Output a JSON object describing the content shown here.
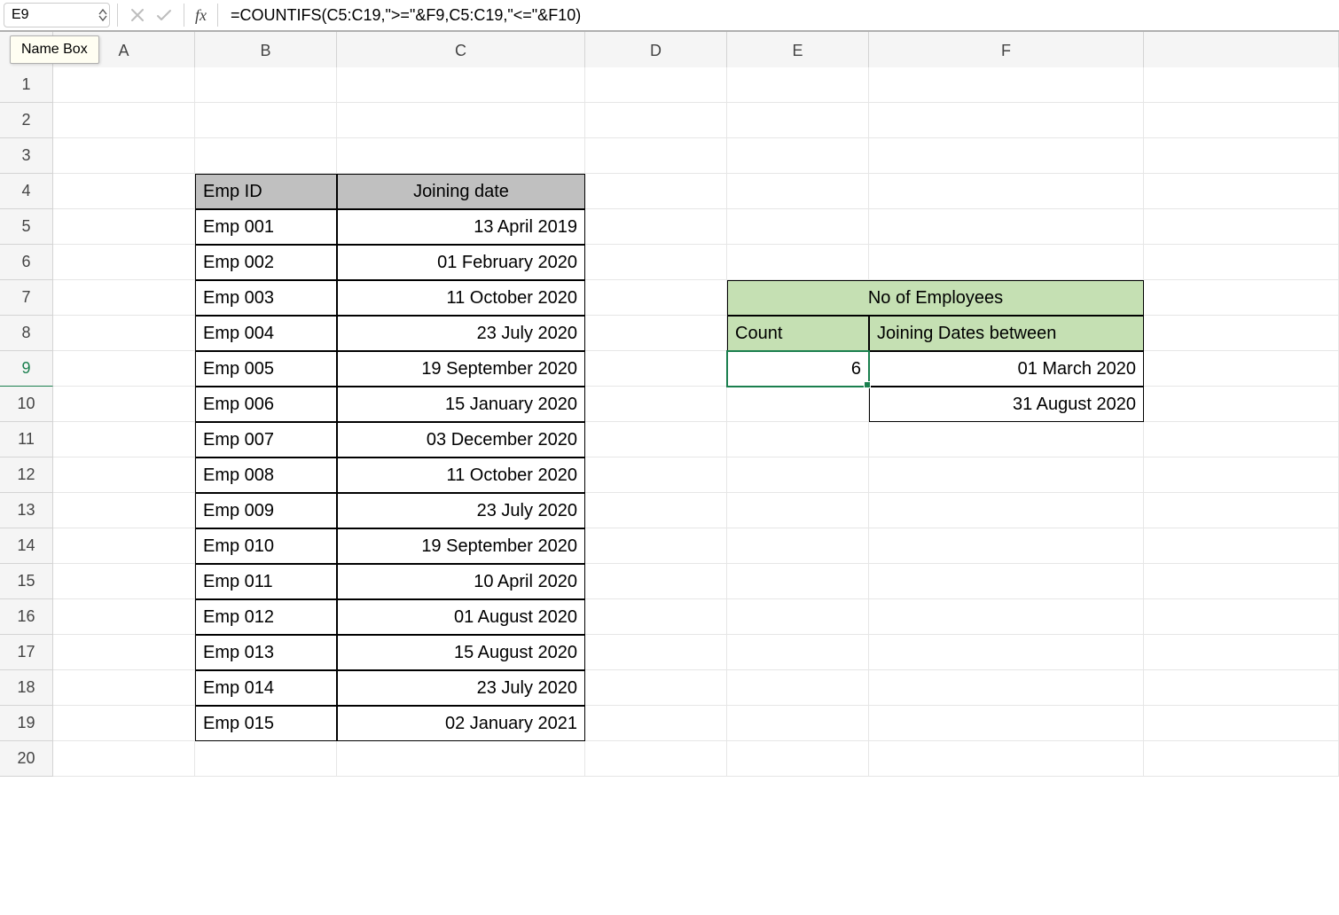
{
  "nameBox": {
    "value": "E9",
    "tooltip": "Name Box"
  },
  "formulaBar": {
    "fxLabel": "fx",
    "formula": "=COUNTIFS(C5:C19,\">=\"&F9,C5:C19,\"<=\"&F10)"
  },
  "columns": [
    "A",
    "B",
    "C",
    "D",
    "E",
    "F",
    ""
  ],
  "rows": [
    "1",
    "2",
    "3",
    "4",
    "5",
    "6",
    "7",
    "8",
    "9",
    "10",
    "11",
    "12",
    "13",
    "14",
    "15",
    "16",
    "17",
    "18",
    "19",
    "20"
  ],
  "headers": {
    "empId": "Emp ID",
    "joining": "Joining date"
  },
  "employees": [
    {
      "id": "Emp 001",
      "date": "13 April 2019"
    },
    {
      "id": "Emp 002",
      "date": "01 February 2020"
    },
    {
      "id": "Emp 003",
      "date": "11 October 2020"
    },
    {
      "id": "Emp 004",
      "date": "23 July 2020"
    },
    {
      "id": "Emp 005",
      "date": "19 September 2020"
    },
    {
      "id": "Emp 006",
      "date": "15 January 2020"
    },
    {
      "id": "Emp 007",
      "date": "03 December 2020"
    },
    {
      "id": "Emp 008",
      "date": "11 October 2020"
    },
    {
      "id": "Emp 009",
      "date": "23 July 2020"
    },
    {
      "id": "Emp 010",
      "date": "19 September 2020"
    },
    {
      "id": "Emp 011",
      "date": "10 April 2020"
    },
    {
      "id": "Emp 012",
      "date": "01 August 2020"
    },
    {
      "id": "Emp 013",
      "date": "15 August 2020"
    },
    {
      "id": "Emp 014",
      "date": "23 July 2020"
    },
    {
      "id": "Emp 015",
      "date": "02 January 2021"
    }
  ],
  "summary": {
    "title": "No of Employees",
    "countLabel": "Count",
    "datesLabel": "Joining Dates between",
    "count": "6",
    "dateFrom": "01 March 2020",
    "dateTo": "31 August 2020"
  },
  "activeCell": "E9"
}
